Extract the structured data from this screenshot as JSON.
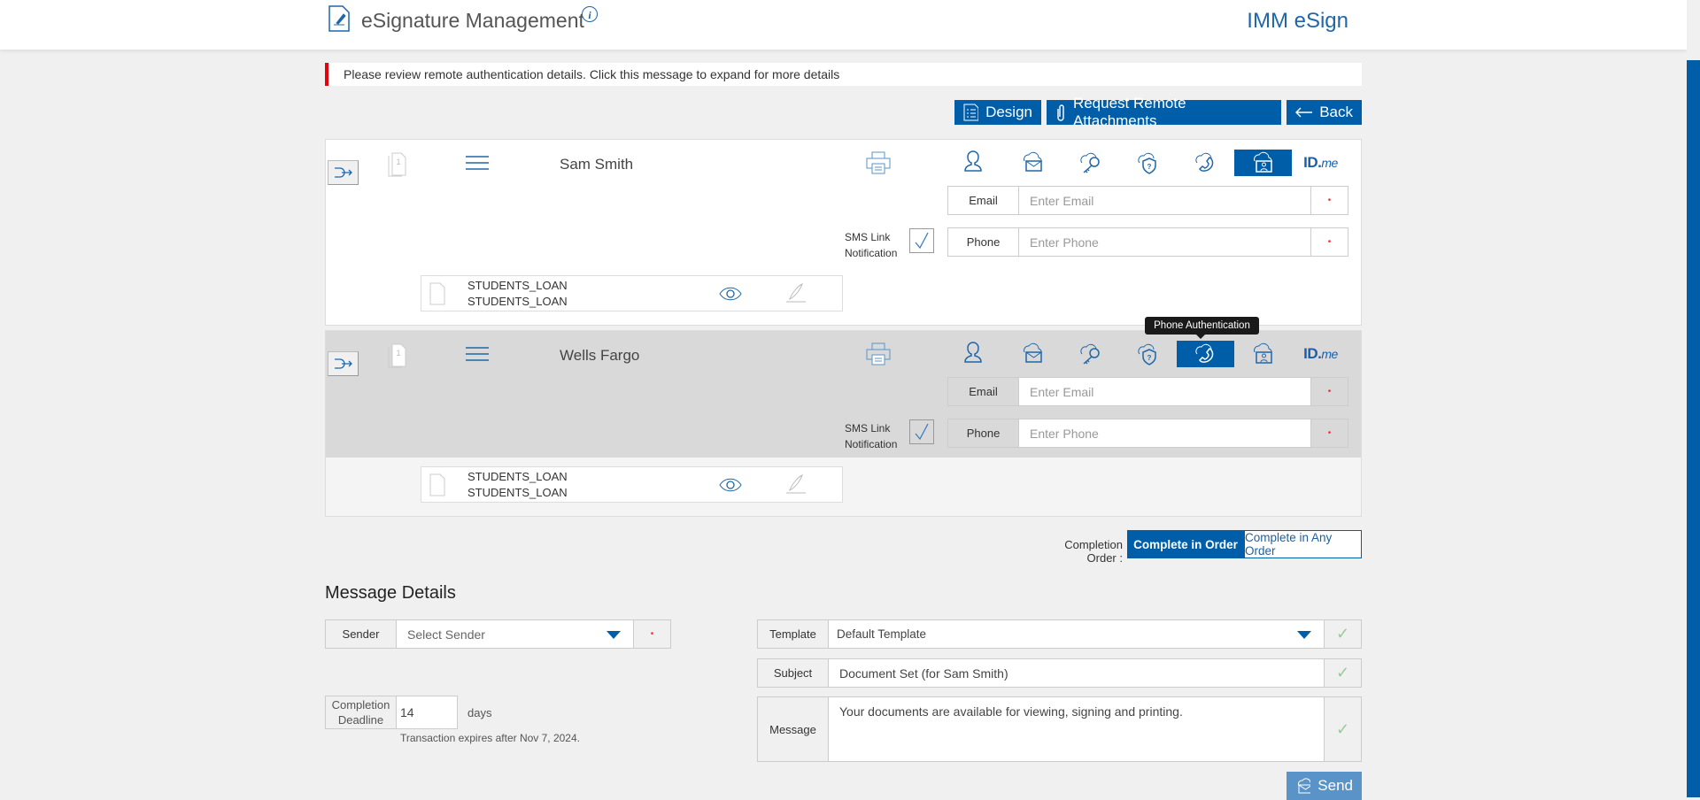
{
  "header": {
    "title": "eSignature Management",
    "brand": "IMM eSign",
    "logo_icon": "esign-document-icon",
    "info_icon": "info-icon"
  },
  "alert": {
    "text": "Please review remote authentication details. Click this message to expand for more details",
    "color": "#e8000b"
  },
  "toolbar": {
    "design": "Design",
    "request_attachments": "Request Remote Attachments",
    "back": "Back"
  },
  "accent": "#005ea8",
  "auth_methods": [
    "person-icon",
    "cloud-email-icon",
    "cloud-key-icon",
    "cloud-shield-question-icon",
    "cloud-phone-icon",
    "cloud-photo-id-icon",
    "idme-logo"
  ],
  "idme": {
    "id": "ID.",
    "me": "me"
  },
  "recipients": [
    {
      "name": "Sam Smith",
      "page_count": "1",
      "selected_auth": "cloud-photo-id-icon",
      "email_label": "Email",
      "email_placeholder": "Enter Email",
      "phone_label": "Phone",
      "phone_placeholder": "Enter Phone",
      "sms_line1": "SMS Link",
      "sms_line2": "Notification",
      "sms_checked": true,
      "required_mark": "•",
      "doc": {
        "line1": "STUDENTS_LOAN",
        "line2": "STUDENTS_LOAN"
      }
    },
    {
      "name": "Wells Fargo",
      "page_count": "1",
      "selected_auth": "cloud-phone-icon",
      "email_label": "Email",
      "email_placeholder": "Enter Email",
      "phone_label": "Phone",
      "phone_placeholder": "Enter Phone",
      "sms_line1": "SMS Link",
      "sms_line2": "Notification",
      "sms_checked": true,
      "required_mark": "•",
      "doc": {
        "line1": "STUDENTS_LOAN",
        "line2": "STUDENTS_LOAN"
      }
    }
  ],
  "tooltip": "Phone Authentication",
  "completion_order": {
    "label": "Completion Order :",
    "options": [
      "Complete in Order",
      "Complete in Any Order"
    ],
    "selected": "Complete in Order"
  },
  "message_details": {
    "heading": "Message Details",
    "sender_label": "Sender",
    "sender_placeholder": "Select Sender",
    "required_mark": "•",
    "deadline_label": "Completion Deadline",
    "deadline_value": "14",
    "deadline_unit": "days",
    "expires": "Transaction expires after Nov 7, 2024.",
    "template_label": "Template",
    "template_value": "Default Template",
    "subject_label": "Subject",
    "subject_value": "Document Set (for Sam Smith)",
    "message_label": "Message",
    "message_value": "Your documents are available for viewing, signing and printing.",
    "check": "✓",
    "send": "Send"
  }
}
